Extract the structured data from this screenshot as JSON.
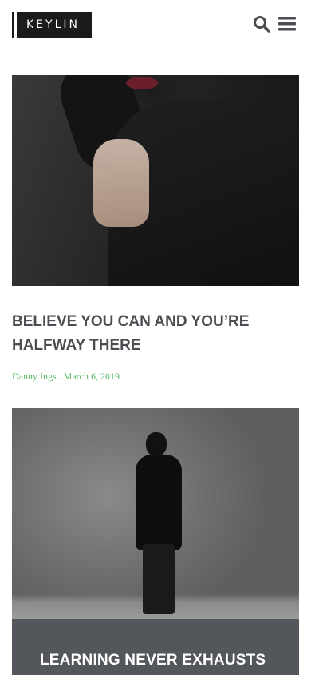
{
  "header": {
    "logo_text": "KEYLIN",
    "icons": [
      "search-icon",
      "menu-icon"
    ]
  },
  "posts": [
    {
      "title": "BELIEVE YOU CAN AND YOU’RE HALFWAY THERE",
      "author": "Danny Ings",
      "separator": ".",
      "date": "March 6, 2019"
    },
    {
      "title": "LEARNING NEVER EXHAUSTS"
    }
  ],
  "colors": {
    "text": "#4a4d51",
    "meta": "#5bb85f",
    "band": "#53565a",
    "logo_bg": "#1b1b1b"
  }
}
